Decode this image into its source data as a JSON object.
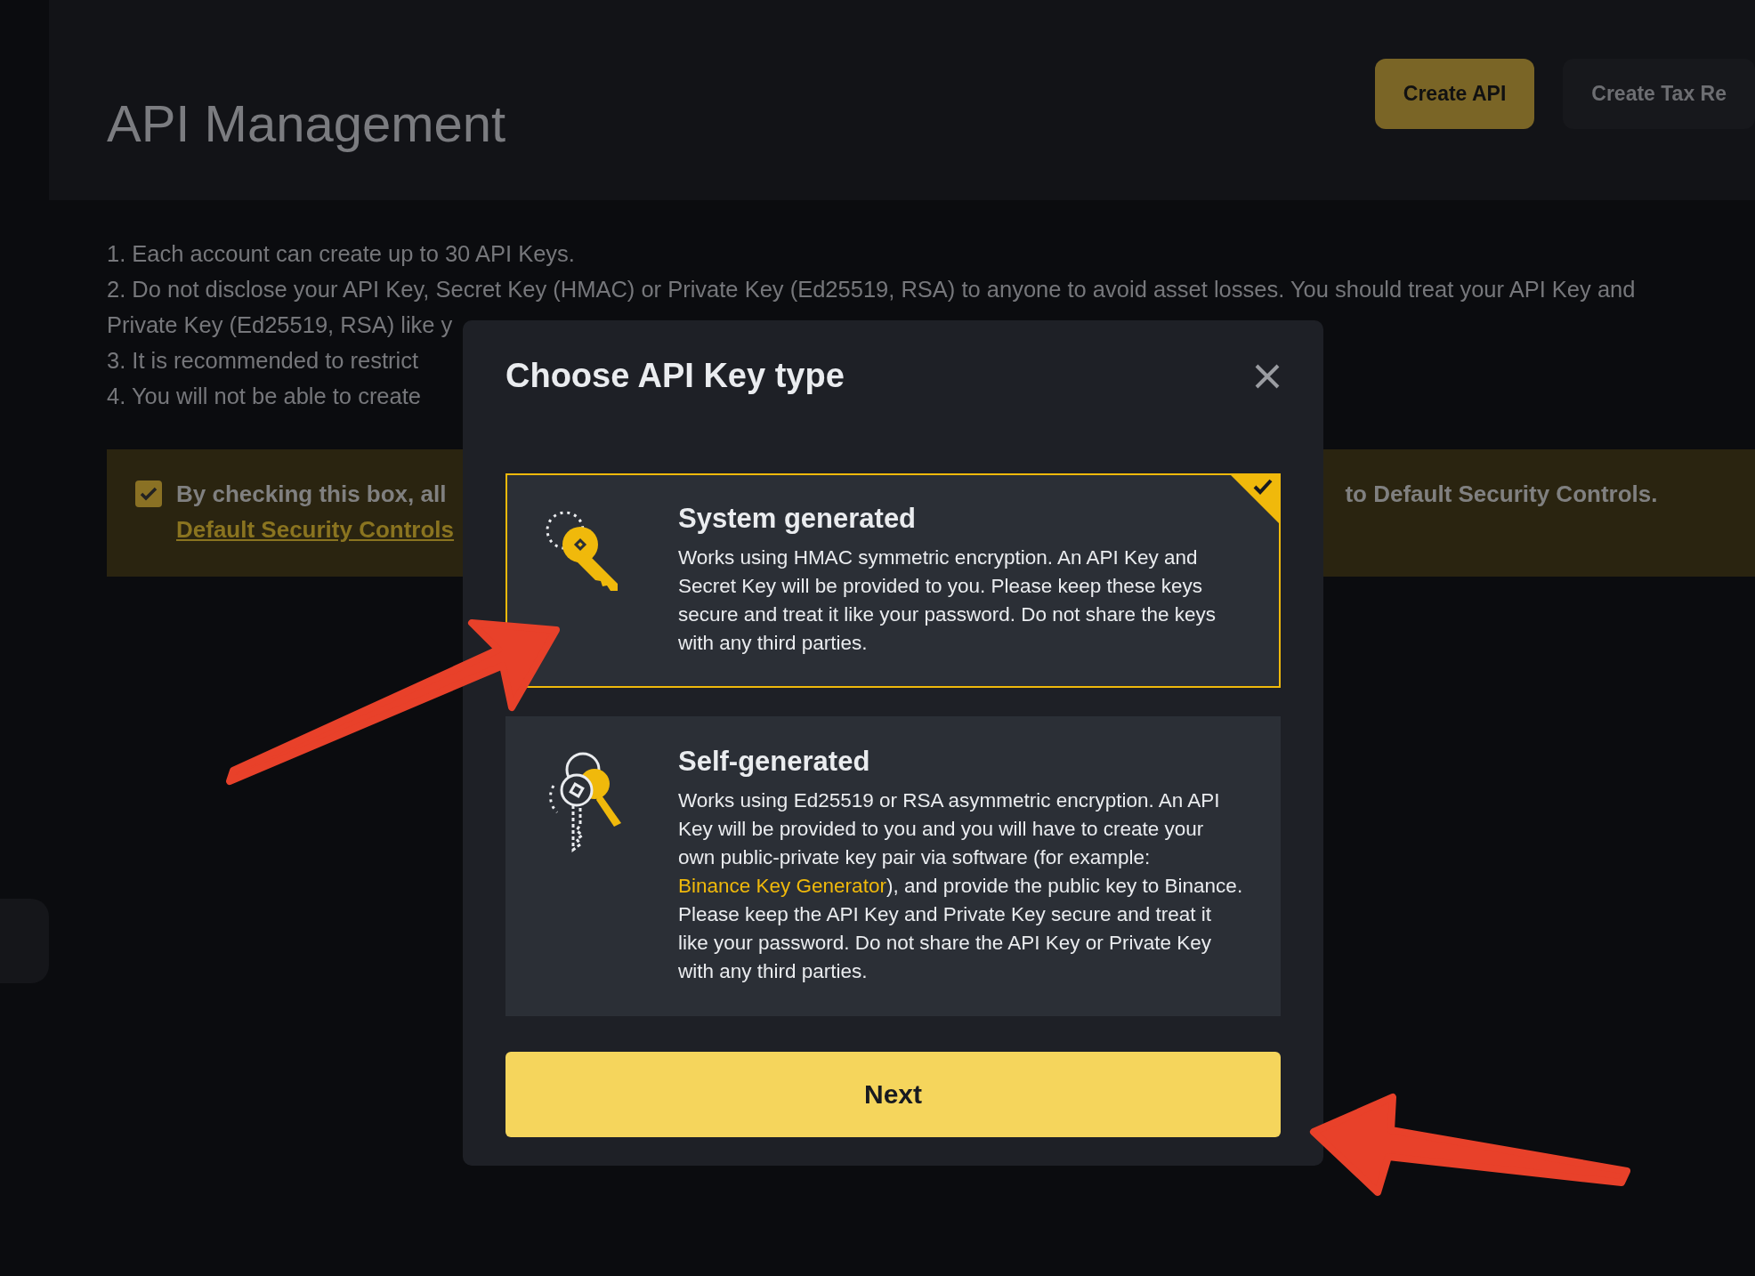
{
  "header": {
    "title": "API Management",
    "buttons": [
      {
        "label": "Create API",
        "kind": "primary"
      },
      {
        "label": "Create Tax Re",
        "kind": "secondary"
      }
    ]
  },
  "notes": [
    "1. Each account can create up to 30 API Keys.",
    "2. Do not disclose your API Key, Secret Key (HMAC) or Private Key (Ed25519, RSA) to anyone to avoid asset losses. You should treat your API Key and",
    "Private Key (Ed25519, RSA) like y",
    "3. It is recommended to restrict",
    "4. You will not be able to create"
  ],
  "agreement": {
    "checked": true,
    "text_left": "By checking this box, all",
    "text_right": "to Default Security Controls.",
    "link": "Default Security Controls"
  },
  "dialog": {
    "title": "Choose API Key type",
    "options": [
      {
        "kind": "single-key",
        "title": "System generated",
        "selected": true,
        "description": "Works using HMAC symmetric encryption. An API Key and Secret Key will be provided to you. Please keep these keys secure and treat it like your password. Do not share the keys with any third parties."
      },
      {
        "kind": "key-pair",
        "title": "Self-generated",
        "selected": false,
        "description": "Works using Ed25519 or RSA asymmetric encryption. An API Key will be provided to you and you will have to create your own public-private key pair via software (for example: ",
        "link": "Binance Key Generator",
        "description_after": "), and provide the public key to Binance. Please keep the API Key and Private Key secure and treat it like your password. Do not share the API Key or Private Key with any third parties."
      }
    ],
    "button": "Next"
  },
  "annotations": [
    {
      "kind": "arrow"
    },
    {
      "kind": "arrow"
    }
  ]
}
